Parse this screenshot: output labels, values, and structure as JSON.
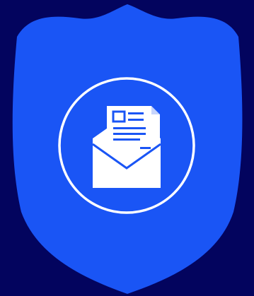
{
  "colors": {
    "background": "#03045e",
    "shield": "#1a55f5",
    "ring": "#ffffff",
    "icon": "#ffffff"
  },
  "icons": {
    "shield": "shield-icon",
    "ring": "circle-ring-icon",
    "mail": "open-envelope-with-letter-icon"
  }
}
